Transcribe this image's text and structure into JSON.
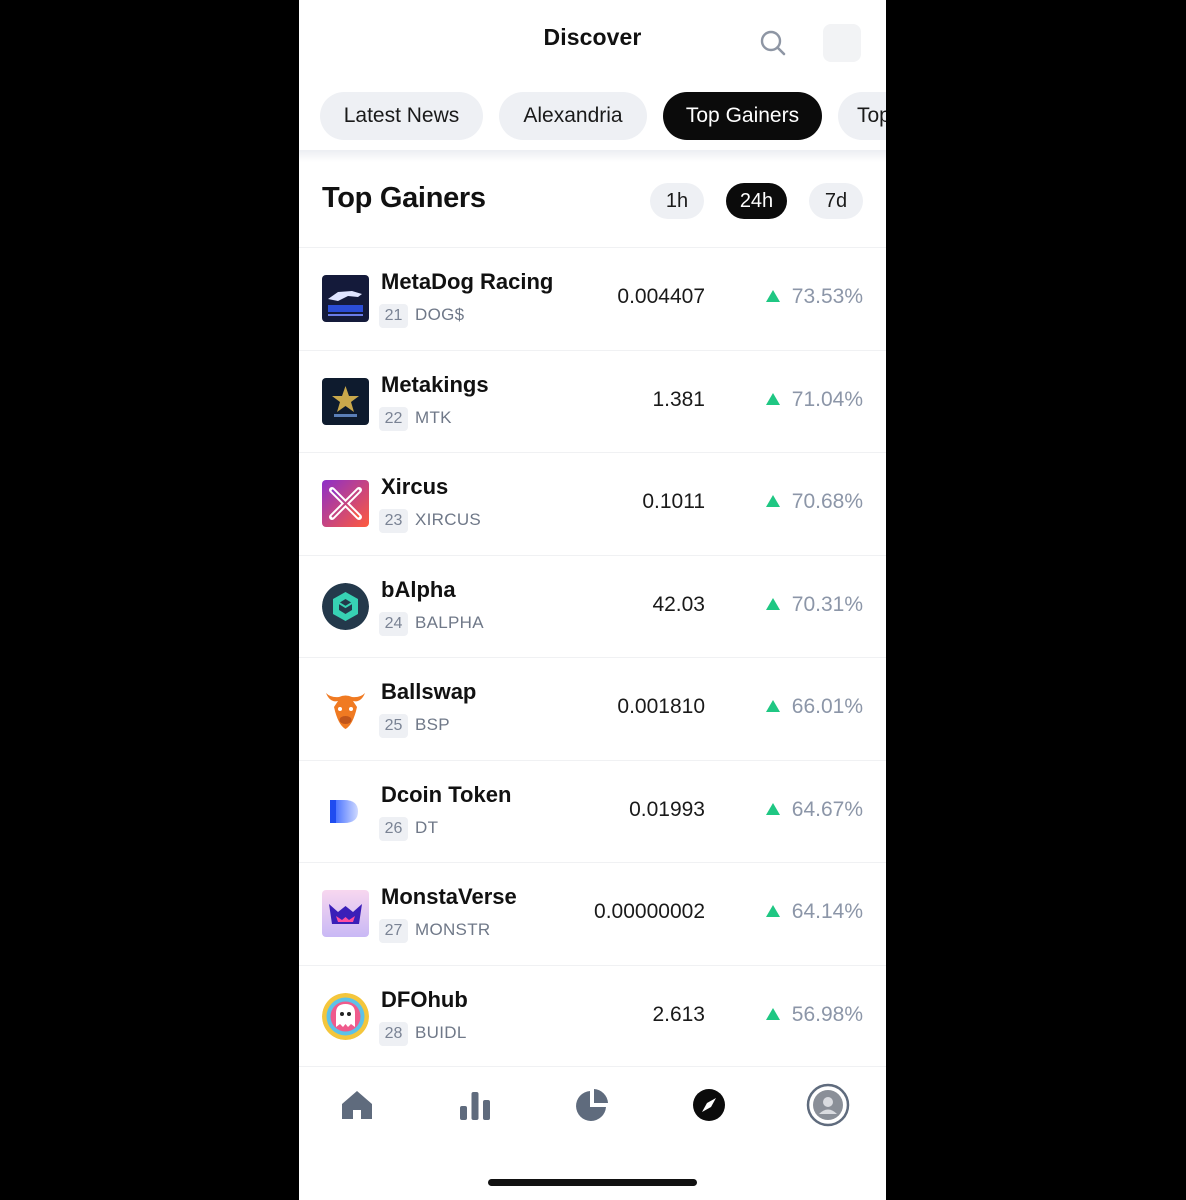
{
  "header": {
    "title": "Discover"
  },
  "tabs": [
    {
      "label": "Latest News",
      "active": false
    },
    {
      "label": "Alexandria",
      "active": false
    },
    {
      "label": "Top Gainers",
      "active": true
    },
    {
      "label": "Top",
      "active": false
    }
  ],
  "section": {
    "title": "Top Gainers",
    "periods": [
      {
        "label": "1h",
        "active": false
      },
      {
        "label": "24h",
        "active": true
      },
      {
        "label": "7d",
        "active": false
      }
    ]
  },
  "coins": [
    {
      "name": "MetaDog Racing",
      "rank": "21",
      "symbol": "DOG$",
      "price": "0.004407",
      "change": "73.53%"
    },
    {
      "name": "Metakings",
      "rank": "22",
      "symbol": "MTK",
      "price": "1.381",
      "change": "71.04%"
    },
    {
      "name": "Xircus",
      "rank": "23",
      "symbol": "XIRCUS",
      "price": "0.1011",
      "change": "70.68%"
    },
    {
      "name": "bAlpha",
      "rank": "24",
      "symbol": "BALPHA",
      "price": "42.03",
      "change": "70.31%"
    },
    {
      "name": "Ballswap",
      "rank": "25",
      "symbol": "BSP",
      "price": "0.001810",
      "change": "66.01%"
    },
    {
      "name": "Dcoin Token",
      "rank": "26",
      "symbol": "DT",
      "price": "0.01993",
      "change": "64.67%"
    },
    {
      "name": "MonstaVerse",
      "rank": "27",
      "symbol": "MONSTR",
      "price": "0.00000002",
      "change": "64.14%"
    },
    {
      "name": "DFOhub",
      "rank": "28",
      "symbol": "BUIDL",
      "price": "2.613",
      "change": "56.98%"
    }
  ],
  "colors": {
    "positive": "#1fc783",
    "active_pill": "#0b0b0b",
    "pill": "#eef0f4",
    "nav_icon": "#5f6b7d"
  },
  "nav": [
    {
      "icon": "home-icon",
      "active": false
    },
    {
      "icon": "bar-chart-icon",
      "active": false
    },
    {
      "icon": "pie-chart-icon",
      "active": false
    },
    {
      "icon": "compass-icon",
      "active": true
    },
    {
      "icon": "avatar-icon",
      "active": false
    }
  ]
}
